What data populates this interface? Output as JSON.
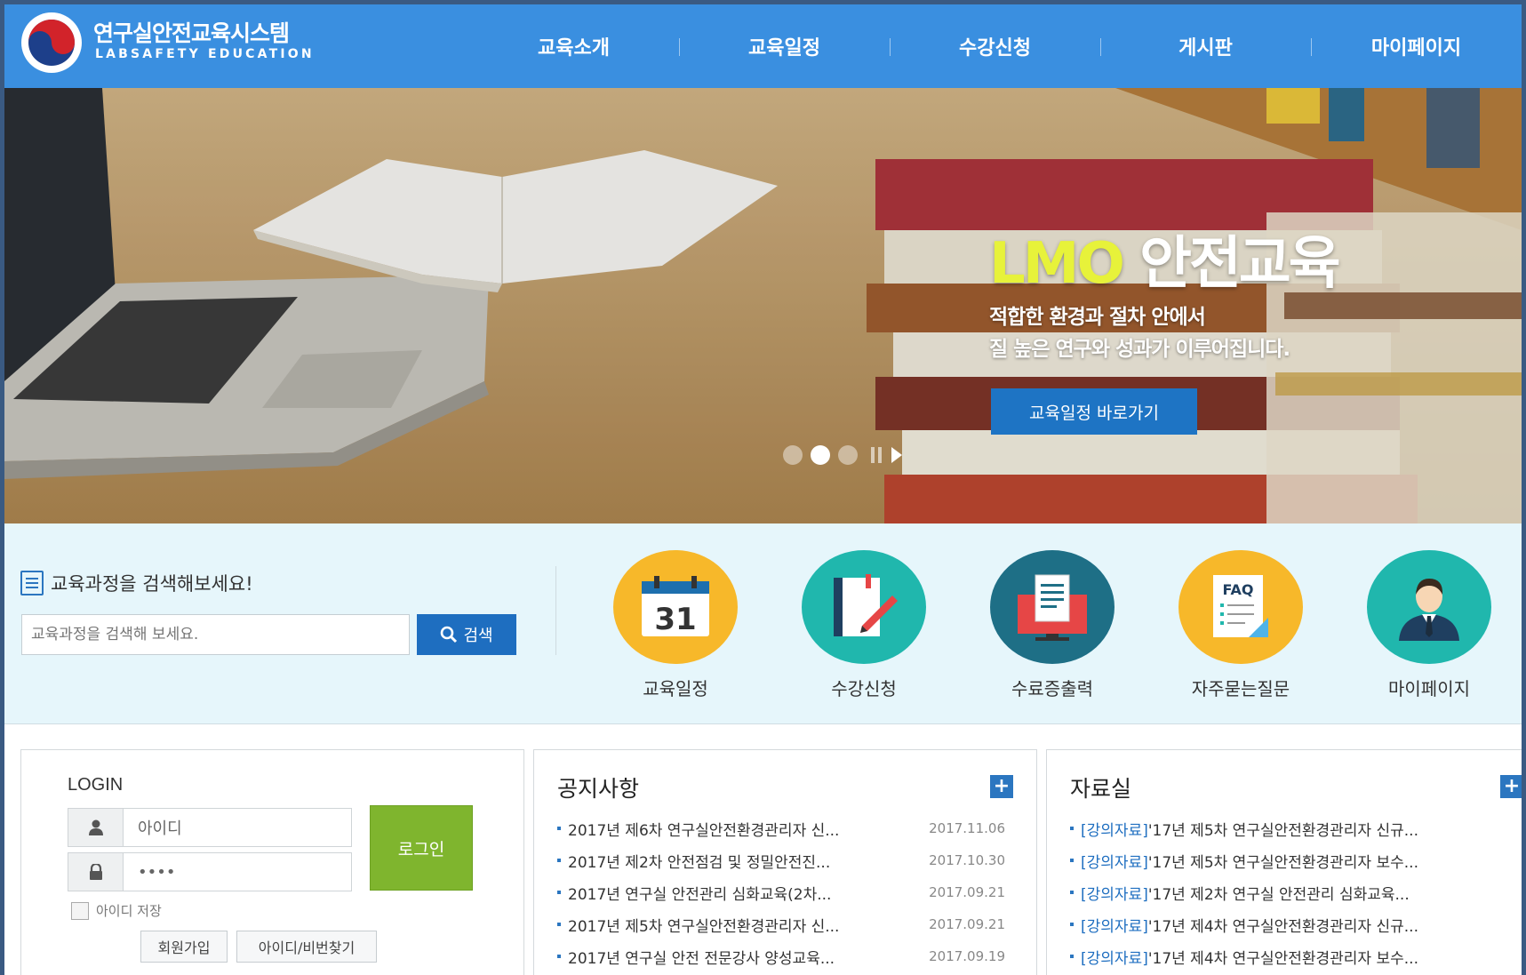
{
  "header": {
    "logo_title": "연구실안전교육시스템",
    "logo_subtitle": "LABSAFETY EDUCATION",
    "nav": [
      "교육소개",
      "교육일정",
      "수강신청",
      "게시판",
      "마이페이지"
    ]
  },
  "hero": {
    "title_accent": "LMO",
    "title_rest": "안전교육",
    "desc_line1": "적합한 환경과 절차 안에서",
    "desc_line2": "질 높은 연구와 성과가 이루어집니다.",
    "button": "교육일정 바로가기",
    "slide_count": 3,
    "active_slide": 2
  },
  "search": {
    "title": "교육과정을 검색해보세요!",
    "placeholder": "교육과정을 검색해 보세요.",
    "button": "검색"
  },
  "quick_links": [
    {
      "label": "교육일정",
      "icon": "calendar-icon",
      "color": "#f7b82a",
      "calendar_day": "31"
    },
    {
      "label": "수강신청",
      "icon": "notebook-pen-icon",
      "color": "#20b7ad"
    },
    {
      "label": "수료증출력",
      "icon": "monitor-document-icon",
      "color": "#1e6f86"
    },
    {
      "label": "자주묻는질문",
      "icon": "faq-icon",
      "color": "#f7b82a",
      "faq_text": "FAQ"
    },
    {
      "label": "마이페이지",
      "icon": "person-icon",
      "color": "#20b7ad"
    }
  ],
  "login": {
    "title": "LOGIN",
    "id_value": "아이디",
    "pw_value": "••••",
    "login_button": "로그인",
    "remember_label": "아이디 저장",
    "signup_button": "회원가입",
    "find_button": "아이디/비번찾기"
  },
  "notices": {
    "title": "공지사항",
    "more": "+",
    "items": [
      {
        "title": "2017년 제6차 연구실안전환경관리자 신...",
        "date": "2017.11.06"
      },
      {
        "title": "2017년 제2차 안전점검 및 정밀안전진...",
        "date": "2017.10.30"
      },
      {
        "title": "2017년 연구실 안전관리 심화교육(2차...",
        "date": "2017.09.21"
      },
      {
        "title": "2017년 제5차 연구실안전환경관리자 신...",
        "date": "2017.09.21"
      },
      {
        "title": "2017년 연구실 안전 전문강사 양성교육...",
        "date": "2017.09.19"
      }
    ]
  },
  "library": {
    "title": "자료실",
    "more": "+",
    "items": [
      {
        "tag": "[강의자료]",
        "title": "'17년 제5차 연구실안전환경관리자 신규..."
      },
      {
        "tag": "[강의자료]",
        "title": "'17년 제5차 연구실안전환경관리자 보수..."
      },
      {
        "tag": "[강의자료]",
        "title": "'17년 제2차 연구실 안전관리 심화교육..."
      },
      {
        "tag": "[강의자료]",
        "title": "'17년 제4차 연구실안전환경관리자 신규..."
      },
      {
        "tag": "[강의자료]",
        "title": "'17년 제4차 연구실안전환경관리자 보수..."
      }
    ]
  }
}
